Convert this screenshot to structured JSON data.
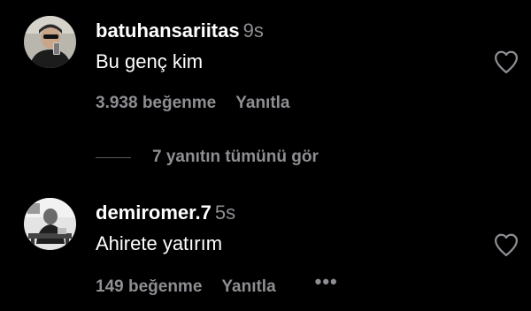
{
  "comments": [
    {
      "username": "batuhansariitas",
      "time": "9s",
      "text": "Bu genç kim",
      "likes_label": "3.938 beğenme",
      "reply_label": "Yanıtla"
    },
    {
      "username": "demiromer.7",
      "time": "5s",
      "text": "Ahirete yatırım",
      "likes_label": "149 beğenme",
      "reply_label": "Yanıtla",
      "more_label": "•••"
    }
  ],
  "view_replies_label": "7 yanıtın tümünü gör",
  "icons": {
    "like": "heart-outline-icon",
    "more": "more-horizontal-icon"
  },
  "colors": {
    "background": "#000000",
    "primary_text": "#ffffff",
    "secondary_text": "#8e8e93"
  }
}
